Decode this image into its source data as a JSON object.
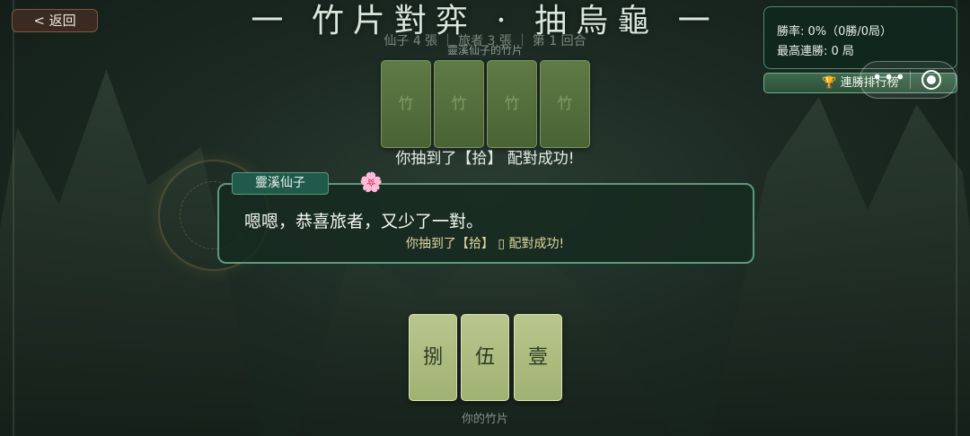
{
  "back_button": "< 返回",
  "title": "一 竹片對弈 · 抽烏龜 一",
  "scoreline": "仙子 4 張 ｜ 旅者 3 張 ｜ 第 1 回合",
  "opponent": {
    "label": "靈溪仙子的竹片",
    "cards": [
      "竹",
      "竹",
      "竹",
      "竹"
    ]
  },
  "draw_message": "你抽到了【拾】 配對成功!",
  "stats": {
    "win_rate": "勝率: 0%（0勝/0局）",
    "best_streak": "最高連勝: 0 局"
  },
  "rank_button": "連勝排行榜",
  "capsule": {
    "more": "•••"
  },
  "dialog": {
    "speaker": "靈溪仙子",
    "flower": "🌸",
    "text": "嗯嗯，恭喜旅者，又少了一對。",
    "sub": "你抽到了【拾】 ▯ 配對成功!"
  },
  "hand": {
    "cards": [
      "捌",
      "伍",
      "壹"
    ],
    "label": "你的竹片"
  },
  "colors": {
    "dialog_border": "#5c9a7c",
    "hand_card": "#b9c78e",
    "opponent_card": "#5f7a45",
    "back_button": "#3a2a22"
  }
}
